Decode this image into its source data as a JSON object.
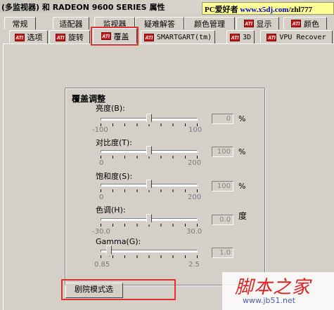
{
  "window": {
    "title": "(多监视器) 和 RADEON 9600 SERIES 属性",
    "watermark": {
      "pre": "PC爱好者",
      "mid": " www.x5dj.com",
      "post": "/zhl777"
    }
  },
  "tabs_row1": [
    {
      "label": "常规",
      "ati": false
    },
    {
      "label": "适配器",
      "ati": false
    },
    {
      "label": "监视器",
      "ati": false
    },
    {
      "label": "疑难解答",
      "ati": false
    },
    {
      "label": "颜色管理",
      "ati": false
    },
    {
      "label": "显示",
      "ati": true
    },
    {
      "label": "颜色",
      "ati": true
    }
  ],
  "tabs_row2": [
    {
      "label": "选项",
      "ati": true
    },
    {
      "label": "旋转",
      "ati": true
    },
    {
      "label": "覆盖",
      "ati": true,
      "active": true
    },
    {
      "label": "SMARTGART(tm)",
      "ati": true
    },
    {
      "label": "3D",
      "ati": true
    },
    {
      "label": "VPU Recover",
      "ati": true
    }
  ],
  "ati_badge": "ATI",
  "overlay": {
    "group_title": "覆盖调整",
    "sliders": [
      {
        "label": "亮度(B):",
        "min": "-100",
        "max": "100",
        "value": "0",
        "unit": "%",
        "position": 0.5
      },
      {
        "label": "对比度(T):",
        "min": "0",
        "max": "200",
        "value": "100",
        "unit": "%",
        "position": 0.5
      },
      {
        "label": "饱和度(S):",
        "min": "0",
        "max": "200",
        "value": "100",
        "unit": "%",
        "position": 0.5
      },
      {
        "label": "色调(H):",
        "min": "-30.0",
        "max": "30.0",
        "value": "0.0",
        "unit": "度",
        "position": 0.5
      },
      {
        "label": "Gamma(G):",
        "min": "0.85",
        "max": "2.5",
        "value": "1.0",
        "unit": "",
        "position": 0.09
      }
    ],
    "bottom_button": "剧院模式选"
  },
  "corner_watermark": {
    "cn": "脚本之家",
    "url": "www.jb51.net"
  }
}
